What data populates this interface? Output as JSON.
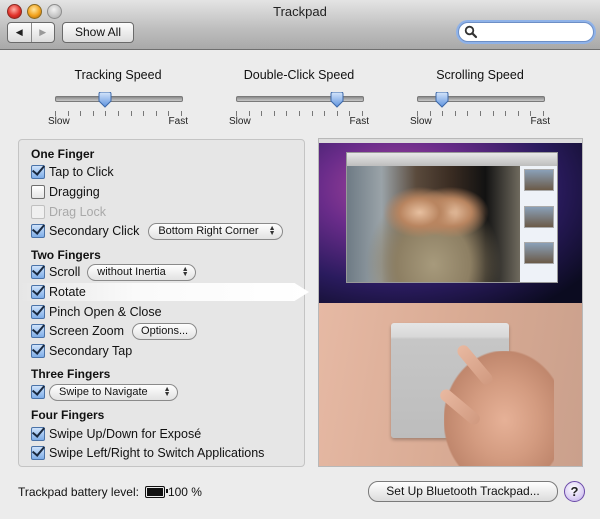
{
  "window": {
    "title": "Trackpad",
    "show_all_label": "Show All",
    "back_icon": "◀",
    "forward_icon": "▶",
    "search": {
      "placeholder": "",
      "value": ""
    }
  },
  "sliders": [
    {
      "label": "Tracking Speed",
      "min_label": "Slow",
      "max_label": "Fast",
      "ticks": 11,
      "value": 0.4
    },
    {
      "label": "Double-Click Speed",
      "min_label": "Slow",
      "max_label": "Fast",
      "ticks": 11,
      "value": 0.8
    },
    {
      "label": "Scrolling Speed",
      "min_label": "Slow",
      "max_label": "Fast",
      "ticks": 11,
      "value": 0.2
    }
  ],
  "one_finger": {
    "title": "One Finger",
    "tap_to_click": {
      "label": "Tap to Click",
      "checked": true
    },
    "dragging": {
      "label": "Dragging",
      "checked": false
    },
    "drag_lock": {
      "label": "Drag Lock",
      "checked": false,
      "disabled": true
    },
    "secondary_click": {
      "label": "Secondary Click",
      "checked": true,
      "option": "Bottom Right Corner"
    }
  },
  "two_fingers": {
    "title": "Two Fingers",
    "scroll": {
      "label": "Scroll",
      "checked": true,
      "option": "without Inertia"
    },
    "rotate": {
      "label": "Rotate",
      "checked": true
    },
    "pinch": {
      "label": "Pinch Open & Close",
      "checked": true
    },
    "screen_zoom": {
      "label": "Screen Zoom",
      "checked": true,
      "button": "Options..."
    },
    "secondary_tap": {
      "label": "Secondary Tap",
      "checked": true
    }
  },
  "three_fingers": {
    "title": "Three Fingers",
    "swipe": {
      "checked": true,
      "option": "Swipe to Navigate"
    }
  },
  "four_fingers": {
    "title": "Four Fingers",
    "expose": {
      "label": "Swipe Up/Down for Exposé",
      "checked": true
    },
    "switch_apps": {
      "label": "Swipe Left/Right to Switch Applications",
      "checked": true
    }
  },
  "footer": {
    "battery_label": "Trackpad battery level:",
    "battery_value": "100 %",
    "battery_level": 1.0,
    "setup_button": "Set Up Bluetooth Trackpad...",
    "help_label": "?"
  }
}
